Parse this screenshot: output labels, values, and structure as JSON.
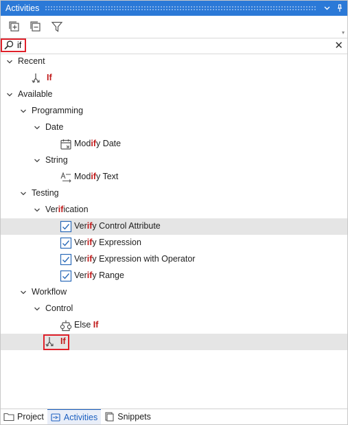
{
  "window": {
    "title": "Activities"
  },
  "search": {
    "value": "if"
  },
  "tree": {
    "recent": {
      "label": "Recent",
      "item": {
        "match": "If",
        "rest": ""
      }
    },
    "available": {
      "label": "Available"
    },
    "programming": {
      "label": "Programming"
    },
    "date": {
      "label": "Date"
    },
    "modify_date": {
      "pre": "Mod",
      "match": "if",
      "post": "y Date"
    },
    "string": {
      "label": "String"
    },
    "modify_text": {
      "pre": "Mod",
      "match": "if",
      "post": "y Text"
    },
    "testing": {
      "label": "Testing"
    },
    "verification": {
      "pre": "Ver",
      "match": "if",
      "post": "ication"
    },
    "verify_items": [
      {
        "pre": "Ver",
        "match": "if",
        "post": "y Control Attribute"
      },
      {
        "pre": "Ver",
        "match": "if",
        "post": "y Expression"
      },
      {
        "pre": "Ver",
        "match": "if",
        "post": "y Expression with Operator"
      },
      {
        "pre": "Ver",
        "match": "if",
        "post": "y Range"
      }
    ],
    "workflow": {
      "label": "Workflow"
    },
    "control": {
      "label": "Control"
    },
    "else_if": {
      "pre": "Else ",
      "match": "If"
    },
    "if_item": {
      "match": "If"
    }
  },
  "tabs": [
    {
      "label": "Project",
      "icon": "folder-icon",
      "active": false
    },
    {
      "label": "Activities",
      "icon": "activities-icon",
      "active": true
    },
    {
      "label": "Snippets",
      "icon": "snippets-icon",
      "active": false
    }
  ],
  "colors": {
    "titlebar": "#2b79d7",
    "match": "#c01818",
    "highlight_box": "#e0202a",
    "active_tab": "#1b5fc0"
  }
}
